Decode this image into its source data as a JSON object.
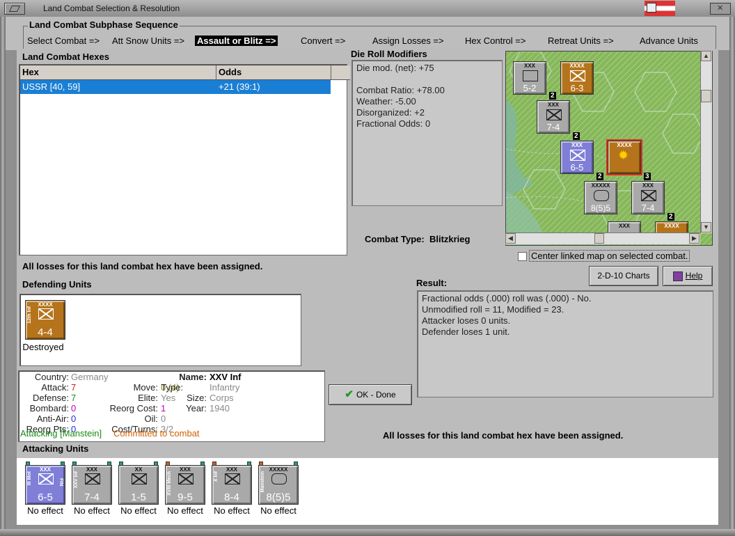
{
  "window": {
    "title": "Land Combat Selection & Resolution"
  },
  "sequence": {
    "title": "Land Combat Subphase Sequence",
    "steps": [
      "Select Combat =>",
      "Att Snow Units =>",
      "Assault or Blitz =>",
      "Convert =>",
      "Assign Losses =>",
      "Hex Control =>",
      "Retreat Units =>",
      "Advance Units"
    ],
    "active_index": 2
  },
  "hexes": {
    "title": "Land Combat Hexes",
    "columns": [
      "Hex",
      "Odds"
    ],
    "rows": [
      {
        "hex": "USSR [40, 59]",
        "odds": "+21 (39:1)"
      }
    ]
  },
  "modifiers": {
    "title": "Die Roll Modifiers",
    "lines": [
      "Die mod. (net): +75",
      "",
      "Combat Ratio: +78.00",
      "Weather: -5.00",
      "Disorganized: +2",
      "Fractional Odds: 0"
    ]
  },
  "combat_type": {
    "label": "Combat Type:",
    "value": "Blitzkrieg"
  },
  "center_map_label": "Center linked map on selected combat.",
  "losses_msg_top": "All losses for this land combat hex have been assigned.",
  "losses_msg_bottom": "All losses for this land combat hex have been assigned.",
  "buttons": {
    "charts": "2-D-10 Charts",
    "help": "Help",
    "ok": "OK - Done"
  },
  "result": {
    "title": "Result:",
    "lines": [
      "Fractional odds (.000) roll was (.000)  - No.",
      "Unmodified roll = 11, Modified = 23.",
      "Attacker loses 0 units.",
      "Defender loses 1 unit."
    ]
  },
  "defending": {
    "title": "Defending Units",
    "units": [
      {
        "size": "XXXX",
        "side": "12th Inf",
        "strength": "4-4",
        "status": "Destroyed"
      }
    ]
  },
  "info": {
    "country_label": "Country:",
    "country": "Germany",
    "attack_label": "Attack:",
    "attack": "7",
    "defense_label": "Defense:",
    "defense": "7",
    "bombard_label": "Bombard:",
    "bombard": "0",
    "antiair_label": "Anti-Air:",
    "antiair": "0",
    "reorgpts_label": "Reorg Pts:",
    "reorgpts": "0",
    "name_label": "Name:",
    "name": "XXV Inf",
    "move_label": "Move:",
    "move_a": "0",
    "move_b": "(4)",
    "type_label": "Type:",
    "type": "Infantry",
    "elite_label": "Elite:",
    "elite": "Yes",
    "size_label": "Size:",
    "size": "Corps",
    "reorgcost_label": "Reorg Cost:",
    "reorgcost": "1",
    "year_label": "Year:",
    "year": "1940",
    "oil_label": "Oil:",
    "oil": "0",
    "costturns_label": "Cost/Turns:",
    "costturns": "3/2",
    "attacking_text": "Attacking [Manstein]",
    "committed_text": "Committed to combat"
  },
  "attacking": {
    "title": "Attacking Units",
    "units": [
      {
        "size": "XXX",
        "side": "III Mot",
        "strength": "6-5",
        "status": "No effect",
        "color": "purple",
        "extra": "FIN"
      },
      {
        "size": "XXX",
        "side": "XXV Inf",
        "strength": "7-4",
        "status": "No effect",
        "color": "grey"
      },
      {
        "size": "XX",
        "side": "",
        "strength": "1-5",
        "status": "No effect",
        "color": "grey"
      },
      {
        "size": "XXX",
        "side": "XVIII Mech",
        "strength": "9-5",
        "status": "No effect",
        "color": "grey"
      },
      {
        "size": "XXX",
        "side": "X Inf",
        "strength": "8-4",
        "status": "No effect",
        "color": "grey"
      },
      {
        "size": "XXXXX",
        "side": "Manstein",
        "strength": "8(5)5",
        "status": "No effect",
        "color": "grey"
      }
    ]
  },
  "map_counters": [
    {
      "size": "XXX",
      "strength": "5-2",
      "color": "grey",
      "badge": ""
    },
    {
      "size": "XXXX",
      "strength": "6-3",
      "color": "brown",
      "badge": "2"
    },
    {
      "size": "XXX",
      "strength": "7-4",
      "color": "grey",
      "badge": "2"
    },
    {
      "size": "XXX",
      "strength": "6-5",
      "color": "purple",
      "badge": ""
    },
    {
      "size": "XXXX",
      "strength": "",
      "color": "brown",
      "badge": ""
    },
    {
      "size": "XXXXX",
      "strength": "8(5)5",
      "color": "grey",
      "badge": "2"
    },
    {
      "size": "XXX",
      "strength": "7-4",
      "color": "grey",
      "badge": "3"
    },
    {
      "size": "XXX",
      "strength": "",
      "color": "grey",
      "badge": ""
    },
    {
      "size": "XXXX",
      "strength": "",
      "color": "brown",
      "badge": "2"
    }
  ],
  "colors": {
    "selection": "#1a7fd4",
    "attack": "#cc2020",
    "defense": "#1a8a1a",
    "bombard": "#c000c0",
    "antiair": "#2030d0",
    "attacking": "#1a8a1a",
    "committed": "#d06000"
  }
}
